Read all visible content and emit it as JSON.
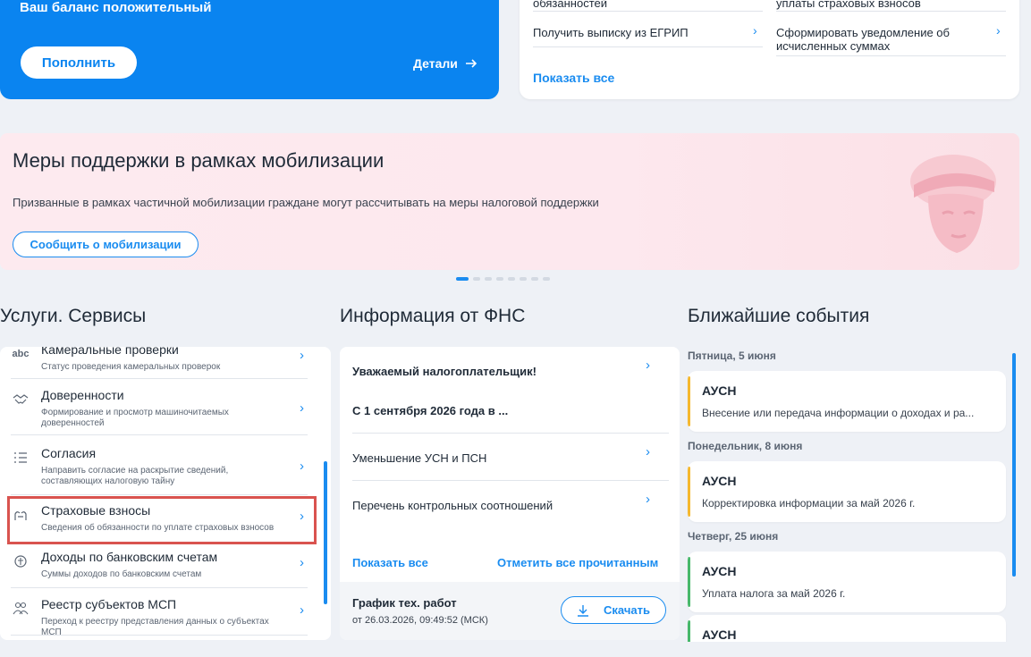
{
  "balance": {
    "status": "Ваш баланс положительный",
    "topup_label": "Пополнить",
    "details_label": "Детали"
  },
  "top_services": {
    "row1_left": "обязанностей",
    "row1_right": "уплаты страховых взносов",
    "row2_left": "Получить выписку из ЕГРИП",
    "row2_right": "Сформировать уведомление об исчисленных суммах",
    "show_all": "Показать все"
  },
  "banner": {
    "title": "Меры поддержки в рамках мобилизации",
    "text": "Призванные в рамках частичной мобилизации граждане могут рассчитывать на меры налоговой поддержки",
    "button": "Сообщить о мобилизации"
  },
  "carousel": {
    "count": 8,
    "active": 0
  },
  "sections": {
    "services": "Услуги. Сервисы",
    "fns": "Информация от ФНС",
    "events": "Ближайшие события"
  },
  "services": [
    {
      "icon": "abc-icon",
      "title": "Камеральные проверки",
      "sub": "Статус проведения камеральных проверок"
    },
    {
      "icon": "handshake-icon",
      "title": "Доверенности",
      "sub": "Формирование и просмотр машиночитаемых доверенностей"
    },
    {
      "icon": "checklist-icon",
      "title": "Согласия",
      "sub": "Направить согласие на раскрытие сведений, составляющих налоговую тайну"
    },
    {
      "icon": "hands-icon",
      "title": "Страховые взносы",
      "sub": "Сведения об обязанности по уплате страховых взносов"
    },
    {
      "icon": "coins-icon",
      "title": "Доходы по банковским счетам",
      "sub": "Суммы доходов по банковским счетам"
    },
    {
      "icon": "people-icon",
      "title": "Реестр субъектов МСП",
      "sub": "Переход к реестру представления данных о субъектах МСП"
    }
  ],
  "fns": {
    "item1_line1": "Уважаемый налогоплательщик!",
    "item1_line2": "С 1 сентября 2026 года в ...",
    "item2": "Уменьшение УСН и ПСН",
    "item3": "Перечень контрольных соотношений",
    "show_all": "Показать все",
    "mark_read": "Отметить все прочитанным",
    "footer_title": "График тех. работ",
    "footer_date": "от 26.03.2026, 09:49:52 (МСК)",
    "download": "Скачать"
  },
  "events": [
    {
      "day": "Пятница, 5 июня",
      "title": "АУСН",
      "sub": "Внесение или передача информации о доходах и ра...",
      "color": "#f5b82e"
    },
    {
      "day": "Понедельник, 8 июня",
      "title": "АУСН",
      "sub": "Корректировка информации за май 2026 г.",
      "color": "#f5b82e"
    },
    {
      "day": "Четверг, 25 июня",
      "title": "АУСН",
      "sub": "Уплата налога за май 2026 г.",
      "color": "#46b86a"
    },
    {
      "day": "",
      "title": "АУСН",
      "sub": "",
      "color": "#46b86a"
    }
  ]
}
